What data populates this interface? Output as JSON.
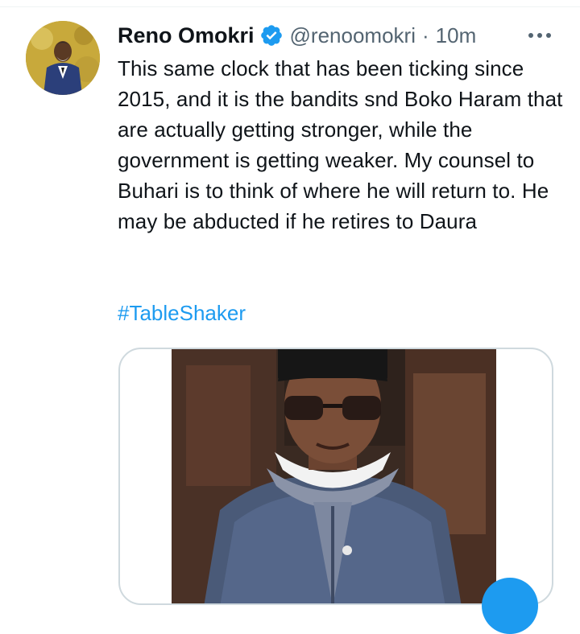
{
  "tweet": {
    "author": {
      "name": "Reno Omokri",
      "handle": "@renoomokri",
      "verified": true
    },
    "separator": "·",
    "timestamp": "10m",
    "text": "This same clock that has been ticking since 2015, and it is the bandits snd Boko Haram that are actually getting stronger, while the government is getting weaker. My counsel to Buhari is to think of where he will return to. He may be abducted if he retires to Daura",
    "hashtag": "#TableShaker",
    "media": {
      "type": "photo"
    }
  },
  "icons": {
    "verified": "verified-badge-icon",
    "more": "more-options-icon"
  },
  "colors": {
    "accent": "#1d9bf0",
    "text_primary": "#0f1419",
    "text_secondary": "#536471",
    "border": "#cfd9de"
  }
}
